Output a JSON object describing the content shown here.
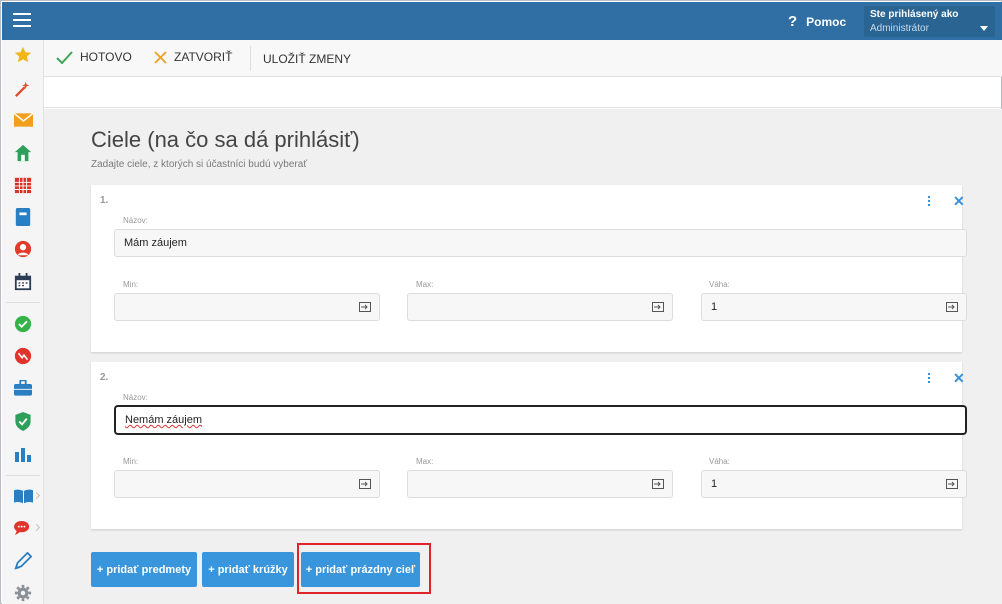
{
  "header": {
    "help_label": "Pomoc",
    "help_icon": "?",
    "user_line1": "Ste prihlásený ako",
    "user_line2": "Administrátor"
  },
  "sidebar": {
    "icons": [
      "star-icon",
      "magic-wand-icon",
      "envelope-icon",
      "home-icon",
      "calendar-grid-icon",
      "notebook-icon",
      "user-icon",
      "schedule-icon",
      "check-circle-icon",
      "chart-down-icon",
      "briefcase-icon",
      "shield-check-icon",
      "bar-chart-icon",
      "book-icon",
      "chat-icon",
      "pen-icon",
      "gear-icon"
    ]
  },
  "toolbar": {
    "done_label": "HOTOVO",
    "close_label": "ZATVORIŤ",
    "save_label": "ULOŽIŤ ZMENY"
  },
  "page": {
    "title": "Ciele (na čo sa dá prihlásiť)",
    "subtitle": "Zadajte ciele, z ktorých si účastníci budú vyberať"
  },
  "goals": [
    {
      "number": "1.",
      "name_label": "Názov:",
      "name_value": "Mám záujem",
      "min_label": "Min:",
      "min_value": "",
      "max_label": "Max:",
      "max_value": "",
      "weight_label": "Váha:",
      "weight_value": "1"
    },
    {
      "number": "2.",
      "name_label": "Názov:",
      "name_value": "Nemám záujem",
      "min_label": "Min:",
      "min_value": "",
      "max_label": "Max:",
      "max_value": "",
      "weight_label": "Váha:",
      "weight_value": "1"
    }
  ],
  "buttons": {
    "add_subjects": "+ pridať predmety",
    "add_clubs": "+ pridať krúžky",
    "add_empty_goal": "+ pridať prázdny cieľ"
  },
  "colors": {
    "header_bg": "#2f6fa3",
    "accent": "#3996dc",
    "highlight": "#e0222a",
    "done_check": "#3aa757",
    "close_x": "#f0a020"
  }
}
